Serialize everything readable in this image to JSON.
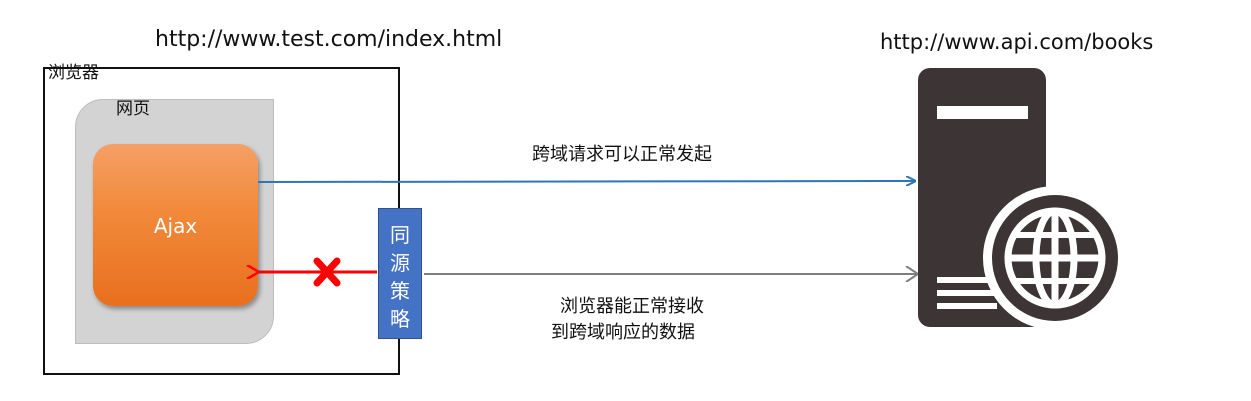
{
  "labels": {
    "origin_url": "http://www.test.com/index.html",
    "api_url": "http://www.api.com/books",
    "browser": "浏览器",
    "webpage": "网页",
    "ajax": "Ajax",
    "policy_chars": [
      "同",
      "源",
      "策",
      "略"
    ],
    "request": "跨域请求可以正常发起",
    "response_line_1": "浏览器能正常接收",
    "response_line_2": "到跨域响应的数据"
  },
  "icons": {
    "server": "server-globe-icon",
    "blocked": "blocked-x-icon"
  },
  "colors": {
    "request_arrow": "#2e75b6",
    "response_arrow": "#7f7f7f",
    "blocked_arrow": "#ff0000",
    "policy_box": "#4472c4",
    "ajax_box": "#f28a3c",
    "server": "#3d3535"
  }
}
